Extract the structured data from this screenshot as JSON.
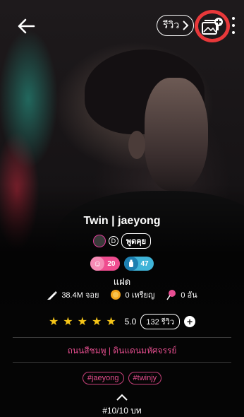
{
  "header": {
    "review_button": "รีวิว",
    "back_icon": "arrow-left-icon",
    "add_story_icon": "story-add-icon",
    "more_icon": "vertical-dots-icon",
    "highlight_color": "#e8383a"
  },
  "story": {
    "title": "Twin | jaeyong",
    "author_badge": "D",
    "author_name": "พูดคุย",
    "badges": [
      {
        "value": "20",
        "color": "#ef4c8f"
      },
      {
        "value": "47",
        "color": "#3fb4d8"
      }
    ],
    "genre": "แฝด",
    "stats": [
      {
        "icon": "pen-icon",
        "text": "38.4M จอย"
      },
      {
        "icon": "coin-icon",
        "text": "0 เหรียญ"
      },
      {
        "icon": "lollipop-icon",
        "text": "0 อัน"
      }
    ],
    "rating": {
      "value": "5.0",
      "stars": 5,
      "count": "132 รีวิว"
    },
    "categories": "ถนนสีชมพู | ดินแดนมหัศจรรย์",
    "hashtags": [
      "#jaeyong",
      "#twinjy"
    ],
    "episodes": "#10/10 บท"
  }
}
